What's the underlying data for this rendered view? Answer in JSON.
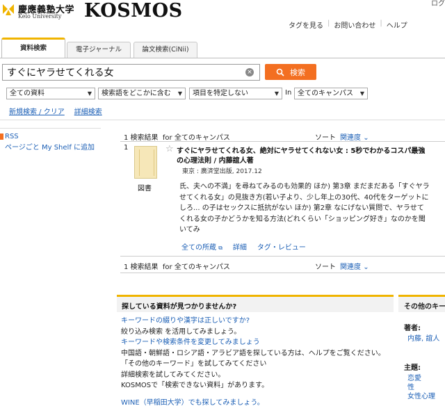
{
  "header": {
    "logo_jp": "慶應義塾大学",
    "logo_en": "Keio University",
    "logo_kosmos": "KOSMOS",
    "top_edge": "ログ",
    "utility": [
      "タグを見る",
      "お問い合わせ",
      "ヘルプ"
    ]
  },
  "tabs": [
    {
      "label": "資料検索",
      "active": true
    },
    {
      "label": "電子ジャーナル",
      "active": false
    },
    {
      "label": "論文検索(CiNii)",
      "active": false
    }
  ],
  "search": {
    "query": "すぐにヤラせてくれる女",
    "clear_label": "×",
    "button_label": "検索",
    "filters": [
      "全ての資料",
      "検索語をどこかに含む",
      "項目を特定しない",
      "全てのキャンパス"
    ],
    "in_label": "In",
    "links": [
      "新規検索 / クリア",
      "詳細検索"
    ]
  },
  "left": {
    "rss": "RSS",
    "myshelf": "ページごと My Shelf に追加"
  },
  "results": {
    "count_label": "1 検索結果",
    "for_label": "for 全てのキャンパス",
    "sort_label": "ソート",
    "sort_value": "関連度",
    "items": [
      {
        "number": "1",
        "type_label": "図書",
        "title": "すぐにヤラせてくれる女、絶対にヤラせてくれない女 : 5秒でわかるコスパ最強の心理法則 / 内藤誼人著",
        "publisher": "東京 : 廣済堂出版, 2017.12",
        "snippet": "氏、夫への不満」を尋ねてみるのも効果的 ほか) 第3章 まだまだある「すぐヤラせてくれる女」の見抜き方(若い子より、少し年上の30代、40代をターゲットにしろ... の子はセックスに抵抗がない ほか) 第2章 なにげない質問で、ヤラせてくれる女の子かどうかを知る方法(どれくらい「ショッピング好き」なのかを聞いてみ",
        "links": [
          "全ての所蔵",
          "詳細",
          "タグ・レビュー"
        ]
      }
    ]
  },
  "help": {
    "heading": "探している資料が見つかりませんか?",
    "lines": [
      "キーワードの綴りや漢字は正しいですか?",
      "絞り込み検索 を活用してみましょう。",
      "キーワードや検索条件を変更してみましょう",
      "中国語・朝鮮語・ロシア語・アラビア語を探している方は、ヘルプをご覧ください。",
      "「その他のキーワード」を試してみてください",
      "詳細検索を試してみてください。",
      "KOSMOSで「検索できない資料」があります。",
      "WINE（早稲田大学）でも探してみましょう。"
    ]
  },
  "side": {
    "heading": "その他のキーワード",
    "author_label": "著者:",
    "author_value": "内藤, 誼人",
    "subject_label": "主題:",
    "subjects": [
      "恋愛",
      "性",
      "女性心理"
    ]
  },
  "colors": {
    "accent": "#f36f21",
    "tab_accent": "#f0b400",
    "link": "#1a5eb5"
  }
}
